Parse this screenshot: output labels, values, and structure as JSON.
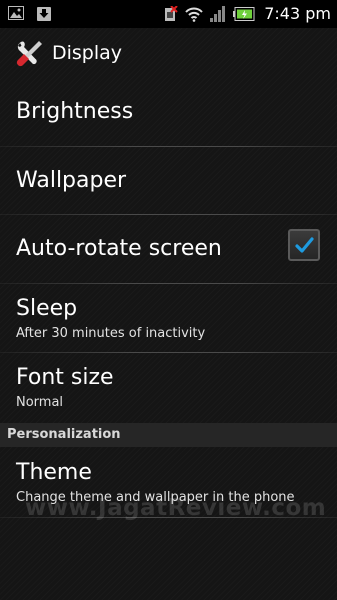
{
  "status_bar": {
    "left_icons": [
      "image-icon",
      "download-icon"
    ],
    "right_icons": [
      "sim-error-icon",
      "wifi-icon",
      "signal-icon",
      "battery-icon"
    ],
    "time": "7:43 pm"
  },
  "action_bar": {
    "icon": "tools-icon",
    "title": "Display"
  },
  "settings": {
    "brightness": {
      "title": "Brightness"
    },
    "wallpaper": {
      "title": "Wallpaper"
    },
    "auto_rotate": {
      "title": "Auto-rotate screen",
      "checked": true
    },
    "sleep": {
      "title": "Sleep",
      "summary": "After 30 minutes of inactivity"
    },
    "font_size": {
      "title": "Font size",
      "summary": "Normal"
    }
  },
  "personalization": {
    "header": "Personalization",
    "theme": {
      "title": "Theme",
      "summary": "Change theme and wallpaper in the phone"
    }
  },
  "watermark": "www.JagatReview.com",
  "colors": {
    "accent": "#1e9be0",
    "background": "#151515",
    "status_bar": "#000000",
    "section_header": "#262626"
  }
}
